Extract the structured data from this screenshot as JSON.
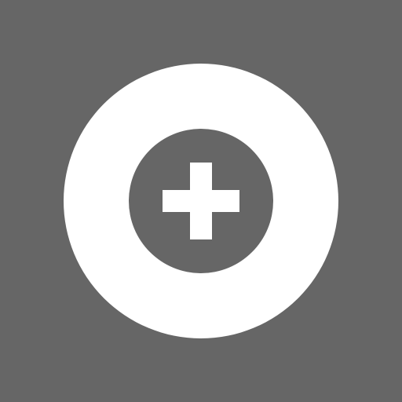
{
  "icon": {
    "name": "add-circle-icon",
    "colors": {
      "background": "#666666",
      "ring": "#ffffff",
      "inner": "#666666",
      "plus": "#ffffff"
    }
  }
}
